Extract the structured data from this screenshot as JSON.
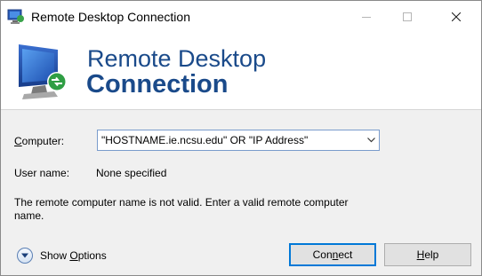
{
  "window": {
    "title": "Remote Desktop Connection"
  },
  "banner": {
    "line1": "Remote Desktop",
    "line2": "Connection"
  },
  "form": {
    "computer_label_pre": "C",
    "computer_label_rest": "omputer:",
    "computer_value": "\"HOSTNAME.ie.ncsu.edu\" OR \"IP Address\"",
    "user_label": "User name:",
    "user_value": "None specified",
    "message": "The remote computer name is not valid. Enter a valid remote computer name."
  },
  "footer": {
    "options_pre": "Show ",
    "options_key": "O",
    "options_rest": "ptions",
    "connect_pre": "Con",
    "connect_key": "n",
    "connect_rest": "ect",
    "help_key": "H",
    "help_rest": "elp"
  },
  "colors": {
    "accent": "#0078d7",
    "banner_text": "#1a4a8a"
  }
}
